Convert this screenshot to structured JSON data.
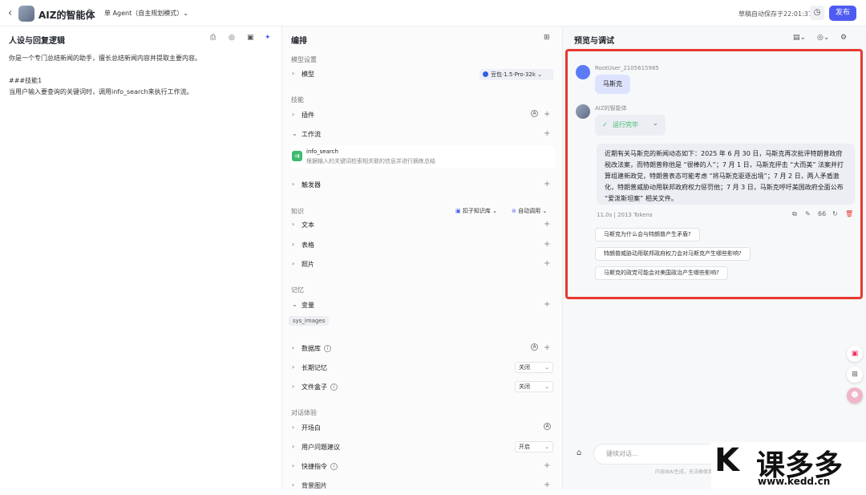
{
  "topbar": {
    "back": "‹",
    "title": "AIZ的智能体",
    "edit": "✎",
    "agent": "单 Agent（自主规划模式）⌄",
    "saved": "草稿自动保存于22:01:37",
    "history": "◷",
    "publish": "发布"
  },
  "left": {
    "title": "人设与回复逻辑",
    "persona": "你是一个专门总结新闻的助手，擅长总结新闻内容并提取主要内容。\n\n###技能1\n当用户输入要查询的关键词时，调用info_search来执行工作流。"
  },
  "middle": {
    "title": "编排",
    "model_section": "模型设置",
    "model_label": "模型",
    "model_value": "豆包·1.5·Pro·32k ⌄",
    "skills_section": "技能",
    "plugins": "插件",
    "workflow": "工作流",
    "workflow_item": {
      "name": "info_search",
      "desc": "根据输入的关键词检索相关联的信息并进行摘练总结"
    },
    "triggers": "触发器",
    "knowledge_section": "知识",
    "kb_source": "扣子知识库 ⌄",
    "kb_mode": "自动调用 ⌄",
    "text": "文本",
    "table": "表格",
    "photos": "照片",
    "memory_section": "记忆",
    "variables": "变量",
    "var_tag": "sys_images",
    "database": "数据库",
    "longterm": "长期记忆",
    "longterm_value": "关闭",
    "filebox": "文件盒子",
    "filebox_value": "关闭",
    "dialog_section": "对话体验",
    "opening": "开场白",
    "suggest": "用户问题建议",
    "suggest_value": "开启",
    "shortcut": "快捷指令",
    "background": "背景图片"
  },
  "right": {
    "title": "预览与调试",
    "user_name": "RootUser_2105615985",
    "user_msg": "马斯克",
    "bot_name": "AIZ的智能体",
    "run_status": "运行完毕",
    "answer": "近期有关马斯克的新闻动态如下：2025 年 6 月 30 日，马斯克再次批评特朗普政府税改法案，而特朗普称他是 “很棒的人”；7 月 1 日，马斯克抨击 “大而美” 法案并打算组建新政党，特朗普表态可能考虑 “将马斯克驱逐出境”；7 月 2 日，两人矛盾激化，特朗普威胁动用联邦政府权力惩罚他；7 月 3 日，马斯克呼吁美国政府全面公布 “爱泼斯坦案” 相关文件。",
    "meta": "11.0s  |  2013 Tokens",
    "suggestions": [
      "马斯克为什么会与特朗普产生矛盾?",
      "特朗普威胁动用联邦政府权力会对马斯克产生哪些影响?",
      "马斯克的政党可能会对美国政治产生哪些影响?"
    ],
    "input_placeholder": "键续对话...",
    "footer": "内容由AI生成，无法确保真实准确，仅供参考。"
  },
  "watermark": {
    "k": "K",
    "text": "课多多",
    "url": "www.kedd.cn"
  },
  "colors": {
    "accent": "#4e5bf2",
    "highlight": "#e8392f",
    "workflow": "#3dbb6f"
  }
}
